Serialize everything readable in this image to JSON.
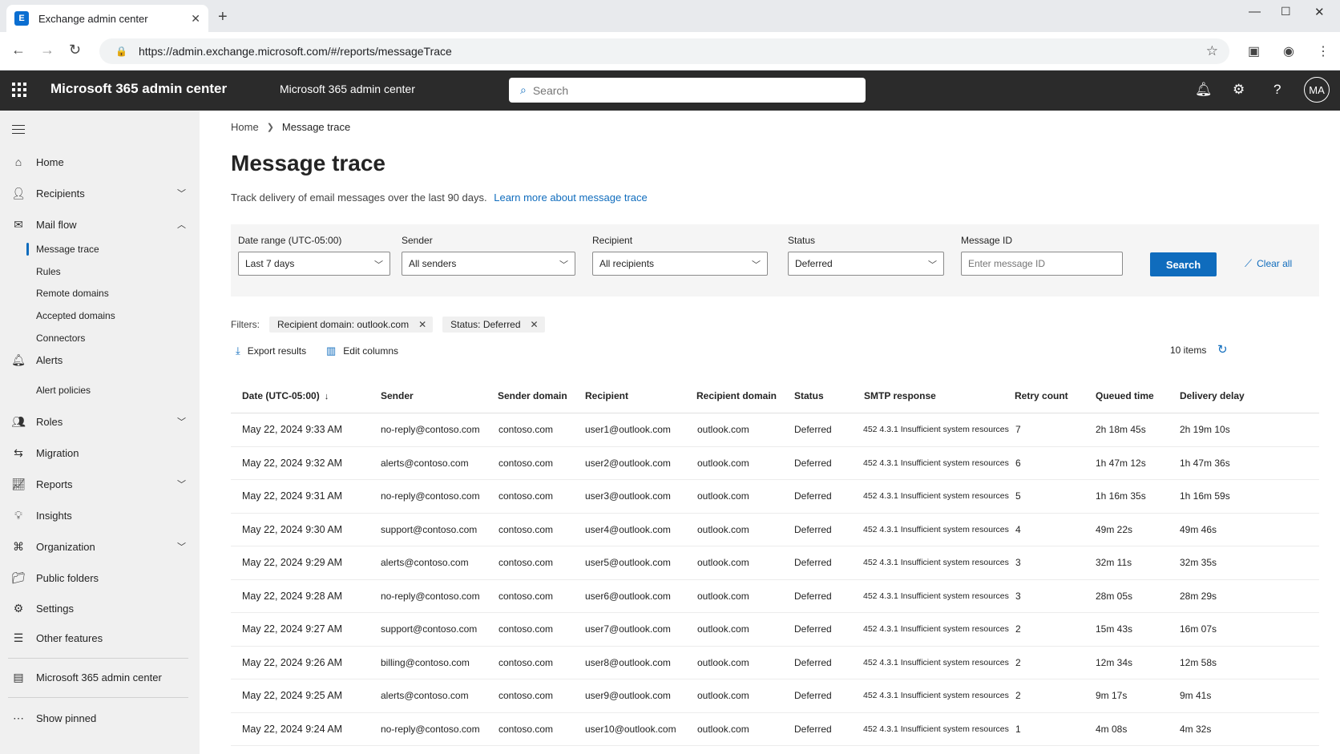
{
  "browser": {
    "tab_title": "Exchange admin center",
    "url": "https://admin.exchange.microsoft.com/#/reports/messageTrace"
  },
  "suite": {
    "app_title": "Microsoft 365 admin center",
    "subtitle": "Microsoft 365 admin center",
    "search_placeholder": "Search",
    "avatar_initials": "MA"
  },
  "sidebar": {
    "home": "Home",
    "recipients": "Recipients",
    "mail_flow": "Mail flow",
    "mail_flow_items": [
      "Message trace",
      "Rules",
      "Remote domains",
      "Accepted domains",
      "Connectors"
    ],
    "alerts": "Alerts",
    "alert_policies": "Alert policies",
    "roles": "Roles",
    "migration": "Migration",
    "reports": "Reports",
    "insights": "Insights",
    "organization": "Organization",
    "public_folders": "Public folders",
    "settings": "Settings",
    "other_features": "Other features",
    "m365_admin": "Microsoft 365 admin center",
    "show_pinned": "Show pinned"
  },
  "breadcrumb": {
    "home": "Home",
    "current": "Message trace"
  },
  "page": {
    "title": "Message trace",
    "description": "Track delivery of email messages over the last 90 days.",
    "learn_more": "Learn more about message trace"
  },
  "filters": {
    "date_range_label": "Date range (UTC-05:00)",
    "date_range_value": "Last 7 days",
    "sender_label": "Sender",
    "sender_value": "All senders",
    "recipient_label": "Recipient",
    "recipient_value": "All recipients",
    "status_label": "Status",
    "status_value": "Deferred",
    "message_id_label": "Message ID",
    "message_id_placeholder": "Enter message ID",
    "search_button": "Search",
    "clear_all": "Clear all"
  },
  "active_filters": {
    "label": "Filters:",
    "pill1": "Recipient domain:  outlook.com",
    "pill2": "Status:  Deferred"
  },
  "toolbar": {
    "export": "Export results",
    "edit_columns": "Edit columns",
    "items_count": "10 items"
  },
  "table": {
    "headers": {
      "date": "Date (UTC-05:00)",
      "sender": "Sender",
      "sender_domain": "Sender domain",
      "recipient": "Recipient",
      "recipient_domain": "Recipient  domain",
      "status": "Status",
      "smtp": "SMTP response",
      "retry": "Retry count",
      "queued": "Queued time",
      "delay": "Delivery delay"
    },
    "rows": [
      {
        "date": "May 22, 2024 9:33 AM",
        "sender": "no-reply@contoso.com",
        "sender_domain": "contoso.com",
        "recipient": "user1@outlook.com",
        "recipient_domain": "outlook.com",
        "status": "Deferred",
        "smtp": "452 4.3.1 Insufficient system resources",
        "retry": "7",
        "queued": "2h 18m 45s",
        "delay": "2h 19m 10s"
      },
      {
        "date": "May 22, 2024 9:32 AM",
        "sender": "alerts@contoso.com",
        "sender_domain": "contoso.com",
        "recipient": "user2@outlook.com",
        "recipient_domain": "outlook.com",
        "status": "Deferred",
        "smtp": "452 4.3.1 Insufficient system resources",
        "retry": "6",
        "queued": "1h 47m 12s",
        "delay": "1h 47m 36s"
      },
      {
        "date": "May 22, 2024 9:31 AM",
        "sender": "no-reply@contoso.com",
        "sender_domain": "contoso.com",
        "recipient": "user3@outlook.com",
        "recipient_domain": "outlook.com",
        "status": "Deferred",
        "smtp": "452 4.3.1 Insufficient system resources",
        "retry": "5",
        "queued": "1h 16m 35s",
        "delay": "1h 16m 59s"
      },
      {
        "date": "May 22, 2024 9:30 AM",
        "sender": "support@contoso.com",
        "sender_domain": "contoso.com",
        "recipient": "user4@outlook.com",
        "recipient_domain": "outlook.com",
        "status": "Deferred",
        "smtp": "452 4.3.1 Insufficient system resources",
        "retry": "4",
        "queued": "49m 22s",
        "delay": "49m 46s"
      },
      {
        "date": "May 22, 2024 9:29 AM",
        "sender": "alerts@contoso.com",
        "sender_domain": "contoso.com",
        "recipient": "user5@outlook.com",
        "recipient_domain": "outlook.com",
        "status": "Deferred",
        "smtp": "452 4.3.1 Insufficient system resources",
        "retry": "3",
        "queued": "32m 11s",
        "delay": "32m 35s"
      },
      {
        "date": "May 22, 2024 9:28 AM",
        "sender": "no-reply@contoso.com",
        "sender_domain": "contoso.com",
        "recipient": "user6@outlook.com",
        "recipient_domain": "outlook.com",
        "status": "Deferred",
        "smtp": "452 4.3.1 Insufficient system resources",
        "retry": "3",
        "queued": "28m 05s",
        "delay": "28m 29s"
      },
      {
        "date": "May 22, 2024 9:27 AM",
        "sender": "support@contoso.com",
        "sender_domain": "contoso.com",
        "recipient": "user7@outlook.com",
        "recipient_domain": "outlook.com",
        "status": "Deferred",
        "smtp": "452 4.3.1 Insufficient system resources",
        "retry": "2",
        "queued": "15m 43s",
        "delay": "16m 07s"
      },
      {
        "date": "May 22, 2024 9:26 AM",
        "sender": "billing@contoso.com",
        "sender_domain": "contoso.com",
        "recipient": "user8@outlook.com",
        "recipient_domain": "outlook.com",
        "status": "Deferred",
        "smtp": "452 4.3.1 Insufficient system resources",
        "retry": "2",
        "queued": "12m 34s",
        "delay": "12m 58s"
      },
      {
        "date": "May 22, 2024 9:25 AM",
        "sender": "alerts@contoso.com",
        "sender_domain": "contoso.com",
        "recipient": "user9@outlook.com",
        "recipient_domain": "outlook.com",
        "status": "Deferred",
        "smtp": "452 4.3.1 Insufficient system resources",
        "retry": "2",
        "queued": "9m 17s",
        "delay": "9m 41s"
      },
      {
        "date": "May 22, 2024 9:24 AM",
        "sender": "no-reply@contoso.com",
        "sender_domain": "contoso.com",
        "recipient": "user10@outlook.com",
        "recipient_domain": "outlook.com",
        "status": "Deferred",
        "smtp": "452 4.3.1 Insufficient system resources",
        "retry": "1",
        "queued": "4m 08s",
        "delay": "4m 32s"
      }
    ]
  },
  "colors": {
    "accent": "#0f6cbd",
    "suitebar": "#2b2b2b",
    "sidebar": "#f0f0f0"
  }
}
